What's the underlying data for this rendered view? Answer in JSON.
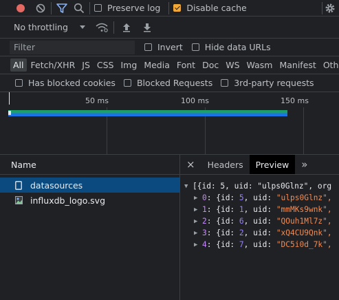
{
  "toolbar": {
    "preserve_log_label": "Preserve log",
    "disable_cache_label": "Disable cache",
    "preserve_log_checked": false,
    "disable_cache_checked": true
  },
  "throttle": {
    "selected": "No throttling"
  },
  "filter": {
    "placeholder": "Filter",
    "invert_label": "Invert",
    "hide_data_urls_label": "Hide data URLs"
  },
  "type_filters": [
    "All",
    "Fetch/XHR",
    "JS",
    "CSS",
    "Img",
    "Media",
    "Font",
    "Doc",
    "WS",
    "Wasm",
    "Manifest",
    "Othe"
  ],
  "blocked": {
    "has_blocked_cookies": "Has blocked cookies",
    "blocked_requests": "Blocked Requests",
    "third_party": "3rd-party requests"
  },
  "timeline": {
    "ticks": [
      "50 ms",
      "100 ms",
      "150 ms"
    ]
  },
  "requests": {
    "header": "Name",
    "items": [
      {
        "name": "datasources",
        "selected": true
      },
      {
        "name": "influxdb_logo.svg",
        "selected": false
      }
    ]
  },
  "detail_tabs": {
    "close": "×",
    "headers": "Headers",
    "preview": "Preview",
    "more": "»"
  },
  "preview": {
    "root": "[{id: 5, uid: \"ulps0Glnz\", org",
    "items": [
      {
        "index": "0",
        "id": "5",
        "uid": "\"ulps0Glnz\","
      },
      {
        "index": "1",
        "id": "1",
        "uid": "\"mmMKs9wnk\","
      },
      {
        "index": "2",
        "id": "6",
        "uid": "\"QOuh1Ml7z\","
      },
      {
        "index": "3",
        "id": "2",
        "uid": "\"xQ4CU9Qnk\","
      },
      {
        "index": "4",
        "id": "7",
        "uid": "\"DC5i0d_7k\","
      }
    ]
  },
  "colors": {
    "record_stop": "#e46962",
    "filter_active": "#8ab4f8",
    "checkbox_on": "#f2a836",
    "selected_row": "#0b4a7f"
  }
}
